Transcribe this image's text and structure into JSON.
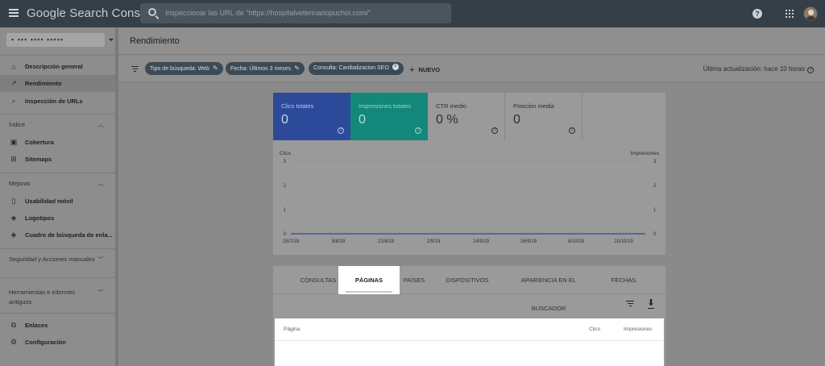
{
  "topbar": {
    "brand": "Google Search Console",
    "search_placeholder": "Inspeccionar las URL de \"https://hospitalveterinariopuchol.com/\"",
    "help_label": "?"
  },
  "sidebar": {
    "property": "▪ ▪▪▪ ▪▪▪▪ ▪▪▪▪▪",
    "top_items": [
      {
        "label": "Descripción general",
        "icon": "home-icon"
      },
      {
        "label": "Rendimiento",
        "icon": "trending-icon"
      },
      {
        "label": "Inspección de URLs",
        "icon": "search-icon"
      }
    ],
    "sections": [
      {
        "title": "Índice",
        "items": [
          {
            "label": "Cobertura",
            "icon": "coverage-icon"
          },
          {
            "label": "Sitemaps",
            "icon": "sitemap-icon"
          }
        ]
      },
      {
        "title": "Mejoras",
        "items": [
          {
            "label": "Usabilidad móvil",
            "icon": "phone-icon"
          },
          {
            "label": "Logotipos",
            "icon": "layers-icon"
          },
          {
            "label": "Cuadro de búsqueda de enla...",
            "icon": "layers-icon"
          }
        ]
      },
      {
        "title": "Seguridad y Acciones manuales"
      },
      {
        "title": "Herramientas e informes antiguos"
      }
    ],
    "bottom_items": [
      {
        "label": "Enlaces",
        "icon": "links-icon"
      },
      {
        "label": "Configuración",
        "icon": "gear-icon"
      }
    ]
  },
  "page": {
    "title": "Rendimiento"
  },
  "filters": {
    "chips": [
      "Tipo de búsqueda: Web",
      "Fecha: Últimos 3 meses",
      "Consulta: Canibalizacion SEO"
    ],
    "new_label": "NUEVO",
    "last_update": "Última actualización: hace 10 horas"
  },
  "metrics": [
    {
      "label": "Clics totales",
      "value": "0"
    },
    {
      "label": "Impresiones totales",
      "value": "0"
    },
    {
      "label": "CTR medio",
      "value": "0 %"
    },
    {
      "label": "Posición media",
      "value": "0"
    }
  ],
  "chart_data": {
    "type": "line",
    "left_axis_label": "Clics",
    "right_axis_label": "Impresiones",
    "y_ticks": [
      "3",
      "2",
      "1",
      "0"
    ],
    "x_ticks": [
      "28/7/19",
      "9/8/19",
      "21/8/19",
      "2/9/19",
      "14/9/19",
      "26/9/19",
      "8/10/19",
      "20/10/19"
    ],
    "ylim": [
      0,
      3
    ],
    "series": [
      {
        "name": "Clics",
        "values": [
          0,
          0,
          0,
          0,
          0,
          0,
          0,
          0
        ]
      },
      {
        "name": "Impresiones",
        "values": [
          0,
          0,
          0,
          0,
          0,
          0,
          0,
          0
        ]
      }
    ],
    "colors": {
      "clicks": "#2d4a9a",
      "grid": "#8e8e8e"
    }
  },
  "tabs": [
    "CONSULTAS",
    "PÁGINAS",
    "PAÍSES",
    "DISPOSITIVOS",
    "APARIENCIA EN EL BUSCADOR",
    "FECHAS"
  ],
  "table": {
    "col_page": "Página",
    "col_clicks": "Clics",
    "col_impressions": "Impresiones"
  }
}
